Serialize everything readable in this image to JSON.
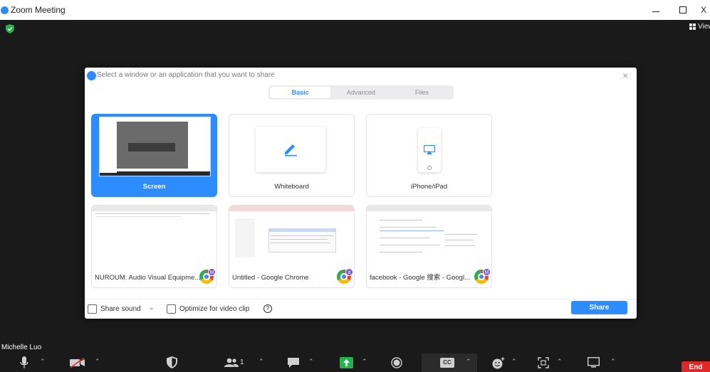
{
  "window": {
    "title": "Zoom Meeting",
    "close_glyph": "X"
  },
  "meeting": {
    "view_label": "View",
    "participant_name": "Michelle Luo"
  },
  "dialog": {
    "title": "Select a window or an application that you want to share",
    "close_glyph": "×",
    "tabs": [
      {
        "label": "Basic",
        "active": true
      },
      {
        "label": "Advanced",
        "active": false
      },
      {
        "label": "Files",
        "active": false
      }
    ],
    "tiles": [
      {
        "label": "Screen",
        "selected": true
      },
      {
        "label": "Whiteboard",
        "selected": false
      },
      {
        "label": "iPhone/iPad",
        "selected": false
      },
      {
        "label": "NUROUM: Audio Visual Equipme...",
        "selected": false,
        "badge": "M"
      },
      {
        "label": "Untitled - Google Chrome",
        "selected": false,
        "badge": "d"
      },
      {
        "label": "facebook - Google 搜索 - Googl...",
        "selected": false,
        "badge": "M"
      }
    ],
    "share_sound_label": "Share sound",
    "optimize_label": "Optimize for video clip",
    "share_button": "Share",
    "help_glyph": "?"
  },
  "toolbar": {
    "participants_count": "1",
    "cc_label": "CC",
    "end_label": "End"
  },
  "colors": {
    "accent": "#2d8cff",
    "end_red": "#e02828",
    "share_green": "#23b24b",
    "shield_green": "#23b24b"
  }
}
